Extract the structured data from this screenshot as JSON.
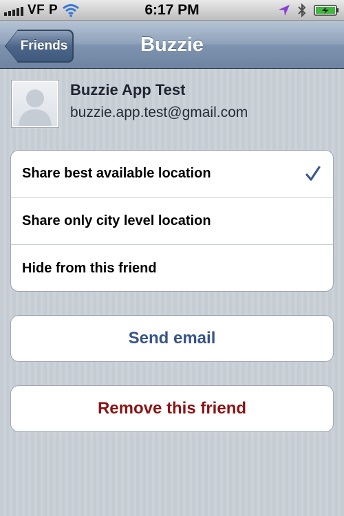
{
  "status_bar": {
    "carrier": "VF P",
    "time": "6:17 PM",
    "icons": [
      "signal-icon",
      "wifi-icon",
      "location-arrow-icon",
      "bluetooth-icon",
      "battery-charging-icon"
    ]
  },
  "nav": {
    "back_label": "Friends",
    "title": "Buzzie"
  },
  "profile": {
    "name": "Buzzie App Test",
    "email": "buzzie.app.test@gmail.com"
  },
  "location_options": [
    {
      "label": "Share best available location",
      "selected": true
    },
    {
      "label": "Share only city level location",
      "selected": false
    },
    {
      "label": "Hide from this friend",
      "selected": false
    }
  ],
  "actions": {
    "send_email": "Send email",
    "remove_friend": "Remove this friend"
  },
  "colors": {
    "nav_bar": "#8fa2bb",
    "send_email_text": "#385487",
    "remove_text": "#8b1414",
    "checkmark": "#3a5a8c"
  }
}
